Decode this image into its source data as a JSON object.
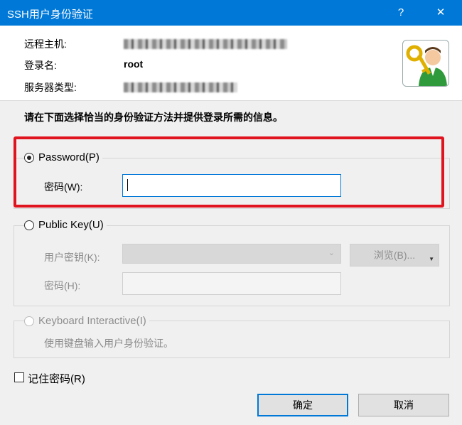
{
  "window": {
    "title": "SSH用户身份验证",
    "help_symbol": "?",
    "close_symbol": "✕"
  },
  "info": {
    "host_label": "远程主机:",
    "user_label": "登录名:",
    "user_value": "root",
    "server_type_label": "服务器类型:"
  },
  "instruction": "请在下面选择恰当的身份验证方法并提供登录所需的信息。",
  "password_group": {
    "label": "Password(P)",
    "selected": true,
    "field_label": "密码(W):",
    "field_value": ""
  },
  "public_key_group": {
    "label": "Public Key(U)",
    "selected": false,
    "user_key_label": "用户密钥(K):",
    "browse_label": "浏览(B)...",
    "passphrase_label": "密码(H):"
  },
  "keyboard_group": {
    "label": "Keyboard Interactive(I)",
    "selected": false,
    "description": "使用键盘输入用户身份验证。"
  },
  "remember_password_label": "记住密码(R)",
  "buttons": {
    "ok_label": "确定",
    "cancel_label": "取消"
  },
  "colors": {
    "titlebar": "#0078d7",
    "highlight": "#e0141e"
  }
}
